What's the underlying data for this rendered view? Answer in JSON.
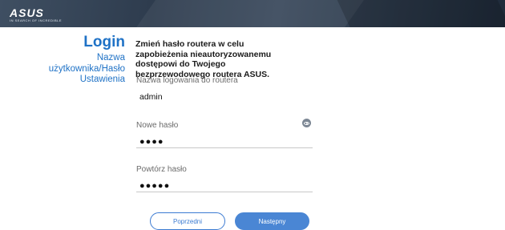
{
  "header": {
    "logo_text": "ASUS",
    "logo_tagline": "IN SEARCH OF INCREDIBLE"
  },
  "sidebar": {
    "title": "Login",
    "subtitle": "Nazwa użytkownika/Hasło Ustawienia"
  },
  "main": {
    "description": "Zmień hasło routera w celu zapobieżenia nieautoryzowanemu dostępowi do Twojego bezprzewodowego routera ASUS.",
    "fields": [
      {
        "label": "Nazwa logowania do routera",
        "value": "admin"
      },
      {
        "label": "Nowe hasło",
        "value": "●●●●"
      },
      {
        "label": "Powtórz hasło",
        "value": "●●●●●"
      }
    ]
  },
  "buttons": {
    "previous": "Poprzedni",
    "next": "Następny"
  },
  "icons": {
    "password_toggle": "eye-icon"
  },
  "colors": {
    "accent": "#1f72c6",
    "button_primary": "#4a86d4",
    "header_bg": "#2e3c4e"
  }
}
